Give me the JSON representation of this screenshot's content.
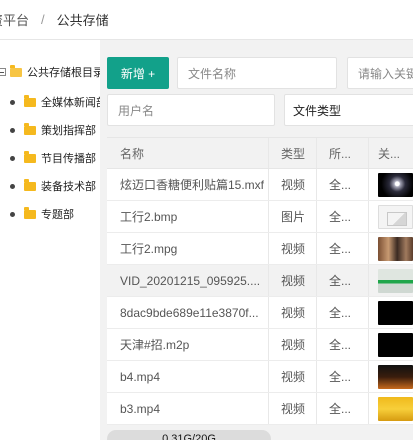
{
  "breadcrumb": {
    "platform": "资平台",
    "separator": "/",
    "current": "公共存储"
  },
  "tree": {
    "root": "公共存储根目录",
    "items": [
      {
        "label": "全媒体新闻部"
      },
      {
        "label": "策划指挥部"
      },
      {
        "label": "节目传播部"
      },
      {
        "label": "装备技术部"
      },
      {
        "label": "专题部"
      }
    ]
  },
  "toolbar": {
    "new_button": "新增 +",
    "filename_placeholder": "文件名称",
    "keyword_placeholder": "请输入关键",
    "username_placeholder": "用户名",
    "filetype_select": "文件类型"
  },
  "table": {
    "headers": [
      "名称",
      "类型",
      "所...",
      "关..."
    ],
    "rows": [
      {
        "name": "炫迈口香糖便利贴篇15.mxf",
        "type": "视频",
        "owner": "全...",
        "thumb": "t1"
      },
      {
        "name": "工行2.bmp",
        "type": "图片",
        "owner": "全...",
        "thumb": "t2"
      },
      {
        "name": "工行2.mpg",
        "type": "视频",
        "owner": "全...",
        "thumb": "t3"
      },
      {
        "name": "VID_20201215_095925....",
        "type": "视频",
        "owner": "全...",
        "thumb": "t4"
      },
      {
        "name": "8dac9bde689e11e3870f...",
        "type": "视频",
        "owner": "全...",
        "thumb": "t5"
      },
      {
        "name": "天津#招.m2p",
        "type": "视频",
        "owner": "全...",
        "thumb": "t6"
      },
      {
        "name": "b4.mp4",
        "type": "视频",
        "owner": "全...",
        "thumb": "t7"
      },
      {
        "name": "b3.mp4",
        "type": "视频",
        "owner": "全...",
        "thumb": "t8"
      }
    ]
  },
  "storage": {
    "label": "0.31G/20G"
  },
  "colors": {
    "accent": "#12a18a",
    "folder": "#f5b91e"
  }
}
